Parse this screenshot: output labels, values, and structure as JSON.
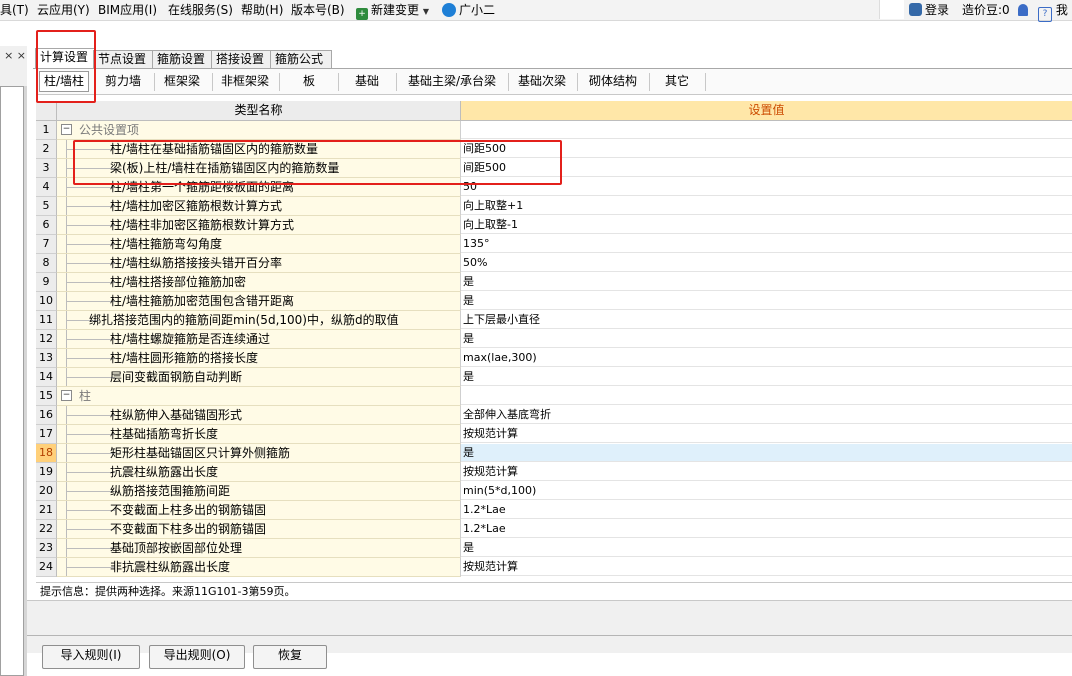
{
  "menu": {
    "items": [
      "具(T)",
      "云应用(Y)",
      "BIM应用(I)",
      "在线服务(S)",
      "帮助(H)",
      "版本号(B)"
    ],
    "new_change": "新建变更",
    "assistant": "广小二",
    "login": "登录",
    "cost_bean": "造价豆:0",
    "me": "我"
  },
  "left_panel": {
    "close": "× ×"
  },
  "main_tabs": [
    "计算设置",
    "节点设置",
    "箍筋设置",
    "搭接设置",
    "箍筋公式"
  ],
  "sub_tabs": [
    "柱/墙柱",
    "剪力墙",
    "框架梁",
    "非框架梁",
    "板",
    "基础",
    "基础主梁/承台梁",
    "基础次梁",
    "砌体结构",
    "其它"
  ],
  "grid": {
    "col_name": "类型名称",
    "col_value": "设置值",
    "selected_row": 18,
    "rows": [
      {
        "num": "1",
        "name": "公共设置项",
        "value": "",
        "group": true
      },
      {
        "num": "2",
        "name": "柱/墙柱在基础插筋锚固区内的箍筋数量",
        "value": "间距500"
      },
      {
        "num": "3",
        "name": "梁(板)上柱/墙柱在插筋锚固区内的箍筋数量",
        "value": "间距500"
      },
      {
        "num": "4",
        "name": "柱/墙柱第一个箍筋距楼板面的距离",
        "value": "50"
      },
      {
        "num": "5",
        "name": "柱/墙柱加密区箍筋根数计算方式",
        "value": "向上取整+1"
      },
      {
        "num": "6",
        "name": "柱/墙柱非加密区箍筋根数计算方式",
        "value": "向上取整-1"
      },
      {
        "num": "7",
        "name": "柱/墙柱箍筋弯勾角度",
        "value": "135°"
      },
      {
        "num": "8",
        "name": "柱/墙柱纵筋搭接接头错开百分率",
        "value": "50%"
      },
      {
        "num": "9",
        "name": "柱/墙柱搭接部位箍筋加密",
        "value": "是"
      },
      {
        "num": "10",
        "name": "柱/墙柱箍筋加密范围包含错开距离",
        "value": "是"
      },
      {
        "num": "11",
        "name": "绑扎搭接范围内的箍筋间距min(5d,100)中，纵筋d的取值",
        "value": "上下层最小直径",
        "indent": "shallow"
      },
      {
        "num": "12",
        "name": "柱/墙柱螺旋箍筋是否连续通过",
        "value": "是"
      },
      {
        "num": "13",
        "name": "柱/墙柱圆形箍筋的搭接长度",
        "value": "max(lae,300)"
      },
      {
        "num": "14",
        "name": "层间变截面钢筋自动判断",
        "value": "是"
      },
      {
        "num": "15",
        "name": "柱",
        "value": "",
        "group": true
      },
      {
        "num": "16",
        "name": "柱纵筋伸入基础锚固形式",
        "value": "全部伸入基底弯折"
      },
      {
        "num": "17",
        "name": "柱基础插筋弯折长度",
        "value": "按规范计算"
      },
      {
        "num": "18",
        "name": "矩形柱基础锚固区只计算外侧箍筋",
        "value": "是"
      },
      {
        "num": "19",
        "name": "抗震柱纵筋露出长度",
        "value": "按规范计算"
      },
      {
        "num": "20",
        "name": "纵筋搭接范围箍筋间距",
        "value": "min(5*d,100)"
      },
      {
        "num": "21",
        "name": "不变截面上柱多出的钢筋锚固",
        "value": "1.2*Lae"
      },
      {
        "num": "22",
        "name": "不变截面下柱多出的钢筋锚固",
        "value": "1.2*Lae"
      },
      {
        "num": "23",
        "name": "基础顶部按嵌固部位处理",
        "value": "是"
      },
      {
        "num": "24",
        "name": "非抗震柱纵筋露出长度",
        "value": "按规范计算"
      }
    ]
  },
  "hint": "提示信息：提供两种选择。来源11G101-3第59页。",
  "buttons": [
    "导入规则(I)",
    "导出规则(O)",
    "恢复"
  ],
  "colors": {
    "highlight_red": "#e3201b",
    "value_header_bg": "#ffe7a8",
    "value_header_text": "#cc4b00",
    "name_cell_bg": "#fffbe6",
    "selected_row_bg": "#dff0fb"
  }
}
